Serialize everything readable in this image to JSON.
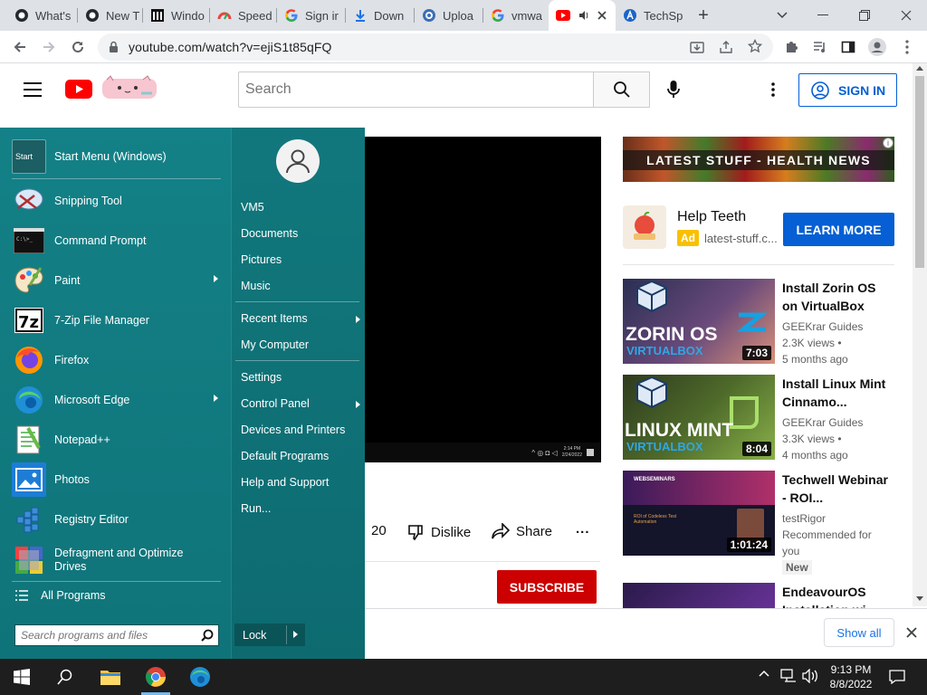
{
  "browser": {
    "tabs": [
      {
        "title": "What's"
      },
      {
        "title": "New T"
      },
      {
        "title": "Windo"
      },
      {
        "title": "Speed"
      },
      {
        "title": "Sign ir"
      },
      {
        "title": "Down"
      },
      {
        "title": "Uploa"
      },
      {
        "title": "vmwa"
      },
      {
        "title": ""
      },
      {
        "title": "TechSp"
      }
    ],
    "new_tab": "+",
    "url": "youtube.com/watch?v=ejiS1t85qFQ"
  },
  "youtube": {
    "search_placeholder": "Search",
    "sign_in": "SIGN IN",
    "video_tray": {
      "time": "2:14 PM",
      "date": "2/24/2022"
    },
    "actions": {
      "likes": "20",
      "dislike": "Dislike",
      "share": "Share",
      "more": "..."
    },
    "subscribe": "SUBSCRIBE",
    "ad": {
      "banner": "LATEST STUFF - HEALTH NEWS",
      "info": "i",
      "title": "Help Teeth",
      "badge": "Ad",
      "site": "latest-stuff.c...",
      "cta": "LEARN MORE"
    },
    "recommendations": [
      {
        "title": "Install Zorin OS on VirtualBox",
        "thumb_big": "ZORIN OS",
        "thumb_small": "VIRTUALBOX",
        "duration": "7:03",
        "channel": "GEEKrar Guides",
        "views": "2.3K views •",
        "age": "5 months ago"
      },
      {
        "title": "Install Linux Mint Cinnamo...",
        "thumb_big": "LINUX MINT",
        "thumb_small": "VIRTUALBOX",
        "duration": "8:04",
        "channel": "GEEKrar Guides",
        "views": "3.3K views •",
        "age": "4 months ago"
      },
      {
        "title": "Techwell Webinar - ROI...",
        "thumb_big": "WEBSEMINARS",
        "thumb_small": "ROI of Codeless Test Automation",
        "duration": "1:01:24",
        "channel": "testRigor",
        "views": "Recommended for you",
        "badge": "New"
      },
      {
        "title": "EndeavourOS Installation wi..."
      }
    ],
    "download_bar": {
      "show_all": "Show all"
    }
  },
  "start_menu": {
    "programs": [
      {
        "label": "Start Menu (Windows)",
        "icon": "start-menu-icon",
        "submenu": false
      },
      {
        "label": "Snipping Tool",
        "icon": "scissors-icon",
        "submenu": false
      },
      {
        "label": "Command Prompt",
        "icon": "terminal-icon",
        "submenu": false
      },
      {
        "label": "Paint",
        "icon": "palette-icon",
        "submenu": true
      },
      {
        "label": "7-Zip File Manager",
        "icon": "7zip-icon",
        "submenu": false
      },
      {
        "label": "Firefox",
        "icon": "firefox-icon",
        "submenu": false
      },
      {
        "label": "Microsoft Edge",
        "icon": "edge-icon",
        "submenu": true
      },
      {
        "label": "Notepad++",
        "icon": "notepad-icon",
        "submenu": false
      },
      {
        "label": "Photos",
        "icon": "photos-icon",
        "submenu": false
      },
      {
        "label": "Registry Editor",
        "icon": "registry-icon",
        "submenu": false
      },
      {
        "label": "Defragment and Optimize Drives",
        "icon": "defrag-icon",
        "submenu": false
      }
    ],
    "start_icon_text": "Start",
    "all_programs": "All Programs",
    "search_placeholder": "Search programs and files",
    "right_items": [
      {
        "label": "VM5",
        "submenu": false
      },
      {
        "label": "Documents",
        "submenu": false
      },
      {
        "label": "Pictures",
        "submenu": false
      },
      {
        "label": "Music",
        "submenu": false
      },
      {
        "label": "Recent Items",
        "submenu": true
      },
      {
        "label": "My Computer",
        "submenu": false
      },
      {
        "label": "Settings",
        "submenu": false
      },
      {
        "label": "Control Panel",
        "submenu": true
      },
      {
        "label": "Devices and Printers",
        "submenu": false
      },
      {
        "label": "Default Programs",
        "submenu": false
      },
      {
        "label": "Help and Support",
        "submenu": false
      },
      {
        "label": "Run...",
        "submenu": false
      }
    ],
    "lock": "Lock"
  },
  "taskbar": {
    "time": "9:13 PM",
    "date": "8/8/2022"
  },
  "colors": {
    "start_menu_bg": "#138187",
    "youtube_red": "#ff0000",
    "link_blue": "#065fd4",
    "taskbar": "#1e1e1e"
  }
}
